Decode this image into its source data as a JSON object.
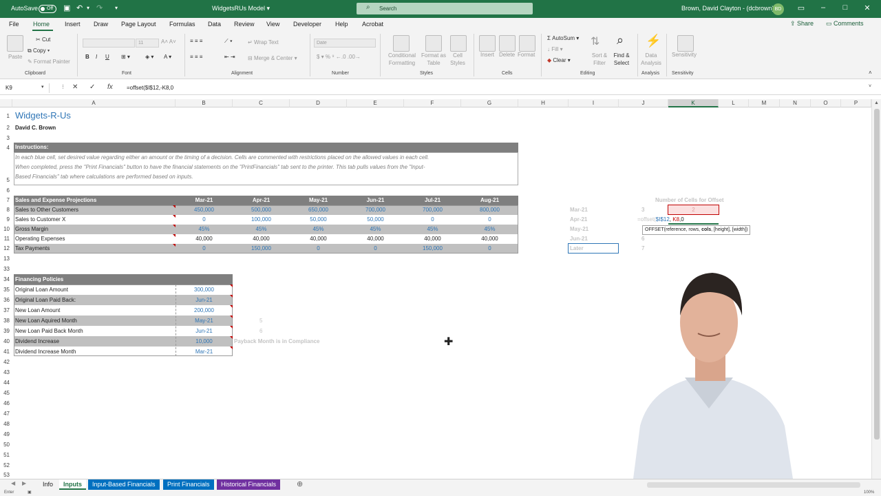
{
  "titlebar": {
    "autosave_label": "AutoSave",
    "autosave_state": "Off",
    "doc_title": "WidgetsRUs Model ▾",
    "search_placeholder": "Search",
    "user_name": "Brown, David Clayton - (dcbrown)",
    "user_initials": "BD"
  },
  "menu": {
    "tabs": [
      "File",
      "Home",
      "Insert",
      "Draw",
      "Page Layout",
      "Formulas",
      "Data",
      "Review",
      "View",
      "Developer",
      "Help",
      "Acrobat"
    ],
    "share": "Share",
    "comments": "Comments"
  },
  "ribbon": {
    "paste": "Paste",
    "cut": "Cut",
    "copy": "Copy",
    "format_painter": "Format Painter",
    "clipboard": "Clipboard",
    "font_size": "11",
    "font": "Font",
    "wrap_text": "Wrap Text",
    "merge_center": "Merge & Center",
    "alignment": "Alignment",
    "number_format": "Date",
    "number": "Number",
    "conditional_formatting": "Conditional Formatting",
    "format_as_table": "Format as Table",
    "cell_styles": "Cell Styles",
    "styles": "Styles",
    "insert": "Insert",
    "delete": "Delete",
    "format": "Format",
    "cells": "Cells",
    "autosum": "AutoSum",
    "fill": "Fill",
    "clear": "Clear",
    "sort_filter": "Sort & Filter",
    "find_select": "Find & Select",
    "editing": "Editing",
    "data_analysis": "Data Analysis",
    "analysis": "Analysis",
    "sensitivity": "Sensitivity"
  },
  "formula_bar": {
    "name_box": "K9",
    "formula": "=offset($I$12,-K8,0"
  },
  "columns": [
    "A",
    "B",
    "C",
    "D",
    "E",
    "F",
    "G",
    "H",
    "I",
    "J",
    "K",
    "L",
    "M",
    "N",
    "O",
    "P"
  ],
  "rows": [
    "1",
    "2",
    "3",
    "4",
    "5",
    "6",
    "7",
    "8",
    "9",
    "10",
    "11",
    "12",
    "13",
    "33",
    "34",
    "35",
    "36",
    "37",
    "38",
    "39",
    "40",
    "41",
    "42",
    "43",
    "44",
    "45",
    "46",
    "47",
    "48",
    "49",
    "50",
    "51",
    "52",
    "53"
  ],
  "sheet": {
    "title": "Widgets-R-Us",
    "author": "David C. Brown",
    "instructions_header": "Instructions:",
    "instructions_line1": "In each blue cell, set desired value regarding either an amount or the timing of a decision.  Cells are commented with restrictions placed on the allowed values in each cell.",
    "instructions_line2": "When completed, press the \"Print Financials\" button to have the financial statements on the \"PrintFinancials\" tab sent to the printer.  This tab pulls values from the \"Input-",
    "instructions_line3": "Based Financials\" tab where calculations are performed based on inputs.",
    "projections_header": "Sales and Expense Projections",
    "months": [
      "Mar-21",
      "Apr-21",
      "May-21",
      "Jun-21",
      "Jul-21",
      "Aug-21"
    ],
    "projection_rows": [
      {
        "label": "Sales to Other Customers",
        "values": [
          "450,000",
          "500,000",
          "650,000",
          "700,000",
          "700,000",
          "800,000"
        ]
      },
      {
        "label": "Sales to Customer X",
        "values": [
          "0",
          "100,000",
          "50,000",
          "50,000",
          "0",
          "0"
        ]
      },
      {
        "label": "Gross Margin",
        "values": [
          "45%",
          "45%",
          "45%",
          "45%",
          "45%",
          "45%"
        ]
      },
      {
        "label": "Operating Expenses",
        "values": [
          "40,000",
          "40,000",
          "40,000",
          "40,000",
          "40,000",
          "40,000"
        ]
      },
      {
        "label": "Tax Payments",
        "values": [
          "0",
          "150,000",
          "0",
          "0",
          "150,000",
          "0"
        ]
      }
    ],
    "offset_header": "Number of Cells for Offset",
    "offset_months": [
      "Mar-21",
      "Apr-21",
      "May-21",
      "Jun-21",
      "Later"
    ],
    "offset_counts": [
      "3",
      "",
      "",
      "6",
      "7"
    ],
    "k8_value": "2",
    "edit_formula_prefix": "=offset(",
    "edit_ref1": "$I$12",
    "edit_sep": ", ",
    "edit_ref2": "K8",
    "edit_tail": ",0",
    "tooltip_prefix": "OFFSET(reference, rows, ",
    "tooltip_bold": "cols",
    "tooltip_suffix": ", [height], [width])",
    "financing_header": "Financing Policies",
    "financing_rows": [
      {
        "label": "Original Loan Amount",
        "value": "300,000"
      },
      {
        "label": "Original Loan Paid Back:",
        "value": "Jun-21"
      },
      {
        "label": "New Loan Amount",
        "value": "200,000"
      },
      {
        "label": "New Loan Aquired Month",
        "value": "May-21"
      },
      {
        "label": "New Loan Paid Back Month",
        "value": "Jun-21"
      },
      {
        "label": "Dividend Increase",
        "value": "10,000"
      },
      {
        "label": "Dividend Increase Month",
        "value": "Mar-21"
      }
    ],
    "c38": "5",
    "c39": "6",
    "compliance_note": "Payback Month is in Compliance"
  },
  "sheet_tabs": [
    {
      "label": "Info",
      "color": "#f3f3f3",
      "text": "#222222"
    },
    {
      "label": "Inputs",
      "color": "#ffffff",
      "text": "#217346"
    },
    {
      "label": "Input-Based Financials",
      "color": "#0070c0",
      "text": "#ffffff"
    },
    {
      "label": "Print Financials",
      "color": "#0070c0",
      "text": "#ffffff"
    },
    {
      "label": "Historical Financials",
      "color": "#7030a0",
      "text": "#ffffff"
    }
  ],
  "status": {
    "mode": "Enter",
    "zoom": "100%"
  },
  "colors": {
    "accent": "#217346",
    "input_blue": "#2e75b6",
    "header_gray": "#7f7f7f",
    "band_gray": "#c0c0c0"
  }
}
